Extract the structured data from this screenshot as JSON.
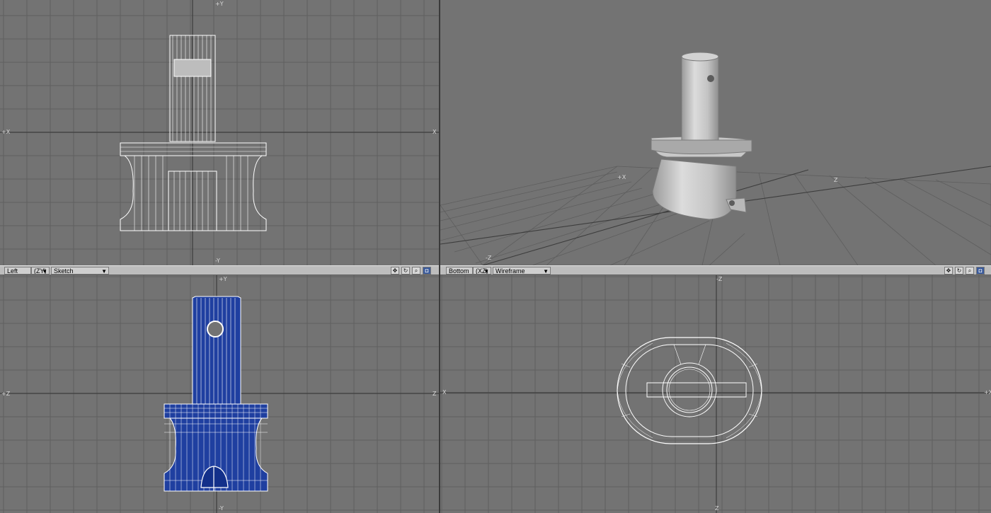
{
  "viewports": {
    "top_left": {
      "axis_labels": {
        "top": "+Y",
        "left": "+X",
        "right": "X",
        "bottom": "-Y"
      }
    },
    "top_right": {
      "axis_labels": {
        "x": "+X",
        "z": "Z",
        "neg_z": "-Z"
      }
    },
    "bottom_left": {
      "toolbar": {
        "view": "Left",
        "axes": "(ZY)",
        "mode": "Sketch"
      },
      "axis_labels": {
        "top": "+Y",
        "left": "+Z",
        "right": "Z",
        "bottom": "-Y"
      }
    },
    "bottom_right": {
      "toolbar": {
        "view": "Bottom",
        "axes": "(XZ)",
        "mode": "Wireframe"
      },
      "axis_labels": {
        "top": "-Z",
        "left": "X",
        "right": "+X",
        "bottom": "Z"
      }
    }
  },
  "icons": [
    "move-view-icon",
    "rotate-view-icon",
    "zoom-view-icon",
    "maximize-view-icon"
  ],
  "colors": {
    "viewport_bg": "#737373",
    "grid": "#5f5f5f",
    "wire": "#ffffff",
    "sketch_blue": "#1f3fa0"
  }
}
